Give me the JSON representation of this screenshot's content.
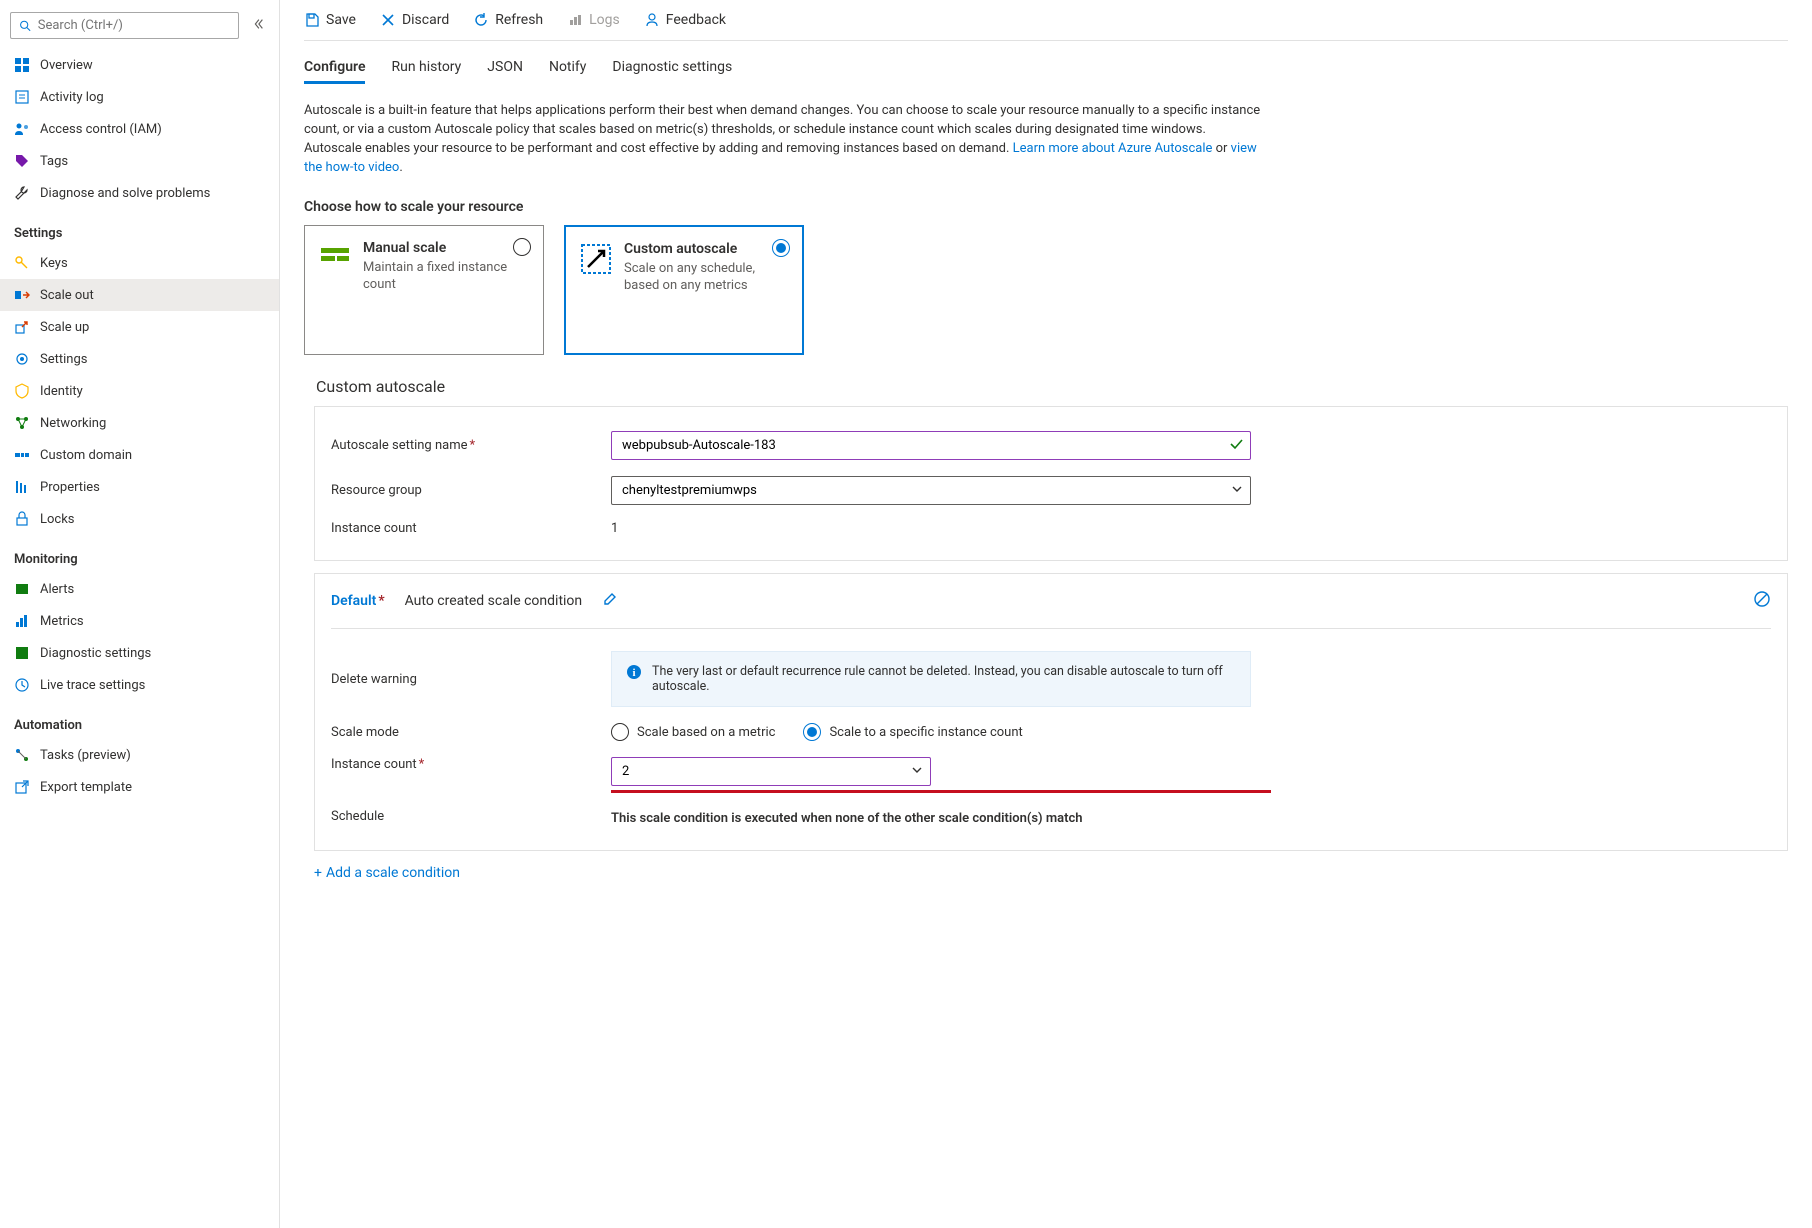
{
  "search": {
    "placeholder": "Search (Ctrl+/)"
  },
  "nav": {
    "top": [
      {
        "label": "Overview"
      },
      {
        "label": "Activity log"
      },
      {
        "label": "Access control (IAM)"
      },
      {
        "label": "Tags"
      },
      {
        "label": "Diagnose and solve problems"
      }
    ],
    "settings_header": "Settings",
    "settings": [
      {
        "label": "Keys"
      },
      {
        "label": "Scale out"
      },
      {
        "label": "Scale up"
      },
      {
        "label": "Settings"
      },
      {
        "label": "Identity"
      },
      {
        "label": "Networking"
      },
      {
        "label": "Custom domain"
      },
      {
        "label": "Properties"
      },
      {
        "label": "Locks"
      }
    ],
    "monitoring_header": "Monitoring",
    "monitoring": [
      {
        "label": "Alerts"
      },
      {
        "label": "Metrics"
      },
      {
        "label": "Diagnostic settings"
      },
      {
        "label": "Live trace settings"
      }
    ],
    "automation_header": "Automation",
    "automation": [
      {
        "label": "Tasks (preview)"
      },
      {
        "label": "Export template"
      }
    ]
  },
  "toolbar": {
    "save": "Save",
    "discard": "Discard",
    "refresh": "Refresh",
    "logs": "Logs",
    "feedback": "Feedback"
  },
  "tabs": {
    "configure": "Configure",
    "run_history": "Run history",
    "json": "JSON",
    "notify": "Notify",
    "diag": "Diagnostic settings"
  },
  "desc": {
    "text": "Autoscale is a built-in feature that helps applications perform their best when demand changes. You can choose to scale your resource manually to a specific instance count, or via a custom Autoscale policy that scales based on metric(s) thresholds, or schedule instance count which scales during designated time windows. Autoscale enables your resource to be performant and cost effective by adding and removing instances based on demand.",
    "learn": "Learn more about Azure Autoscale",
    "or": " or ",
    "video": "view the how-to video",
    "dot": "."
  },
  "choose_head": "Choose how to scale your resource",
  "cards": {
    "manual": {
      "title": "Manual scale",
      "sub": "Maintain a fixed instance count"
    },
    "custom": {
      "title": "Custom autoscale",
      "sub": "Scale on any schedule, based on any metrics"
    }
  },
  "subhead": "Custom autoscale",
  "form": {
    "name_label": "Autoscale setting name",
    "name_value": "webpubsub-Autoscale-183",
    "rg_label": "Resource group",
    "rg_value": "chenyltestpremiumwps",
    "inst_label": "Instance count",
    "inst_value": "1"
  },
  "cond": {
    "default": "Default",
    "name": "Auto created scale condition",
    "del_label": "Delete warning",
    "del_msg": "The very last or default recurrence rule cannot be deleted. Instead, you can disable autoscale to turn off autoscale.",
    "mode_label": "Scale mode",
    "mode_metric": "Scale based on a metric",
    "mode_fixed": "Scale to a specific instance count",
    "inst_label": "Instance count",
    "inst_value": "2",
    "sched_label": "Schedule",
    "sched_note": "This scale condition is executed when none of the other scale condition(s) match"
  },
  "add_cond": "Add a scale condition"
}
